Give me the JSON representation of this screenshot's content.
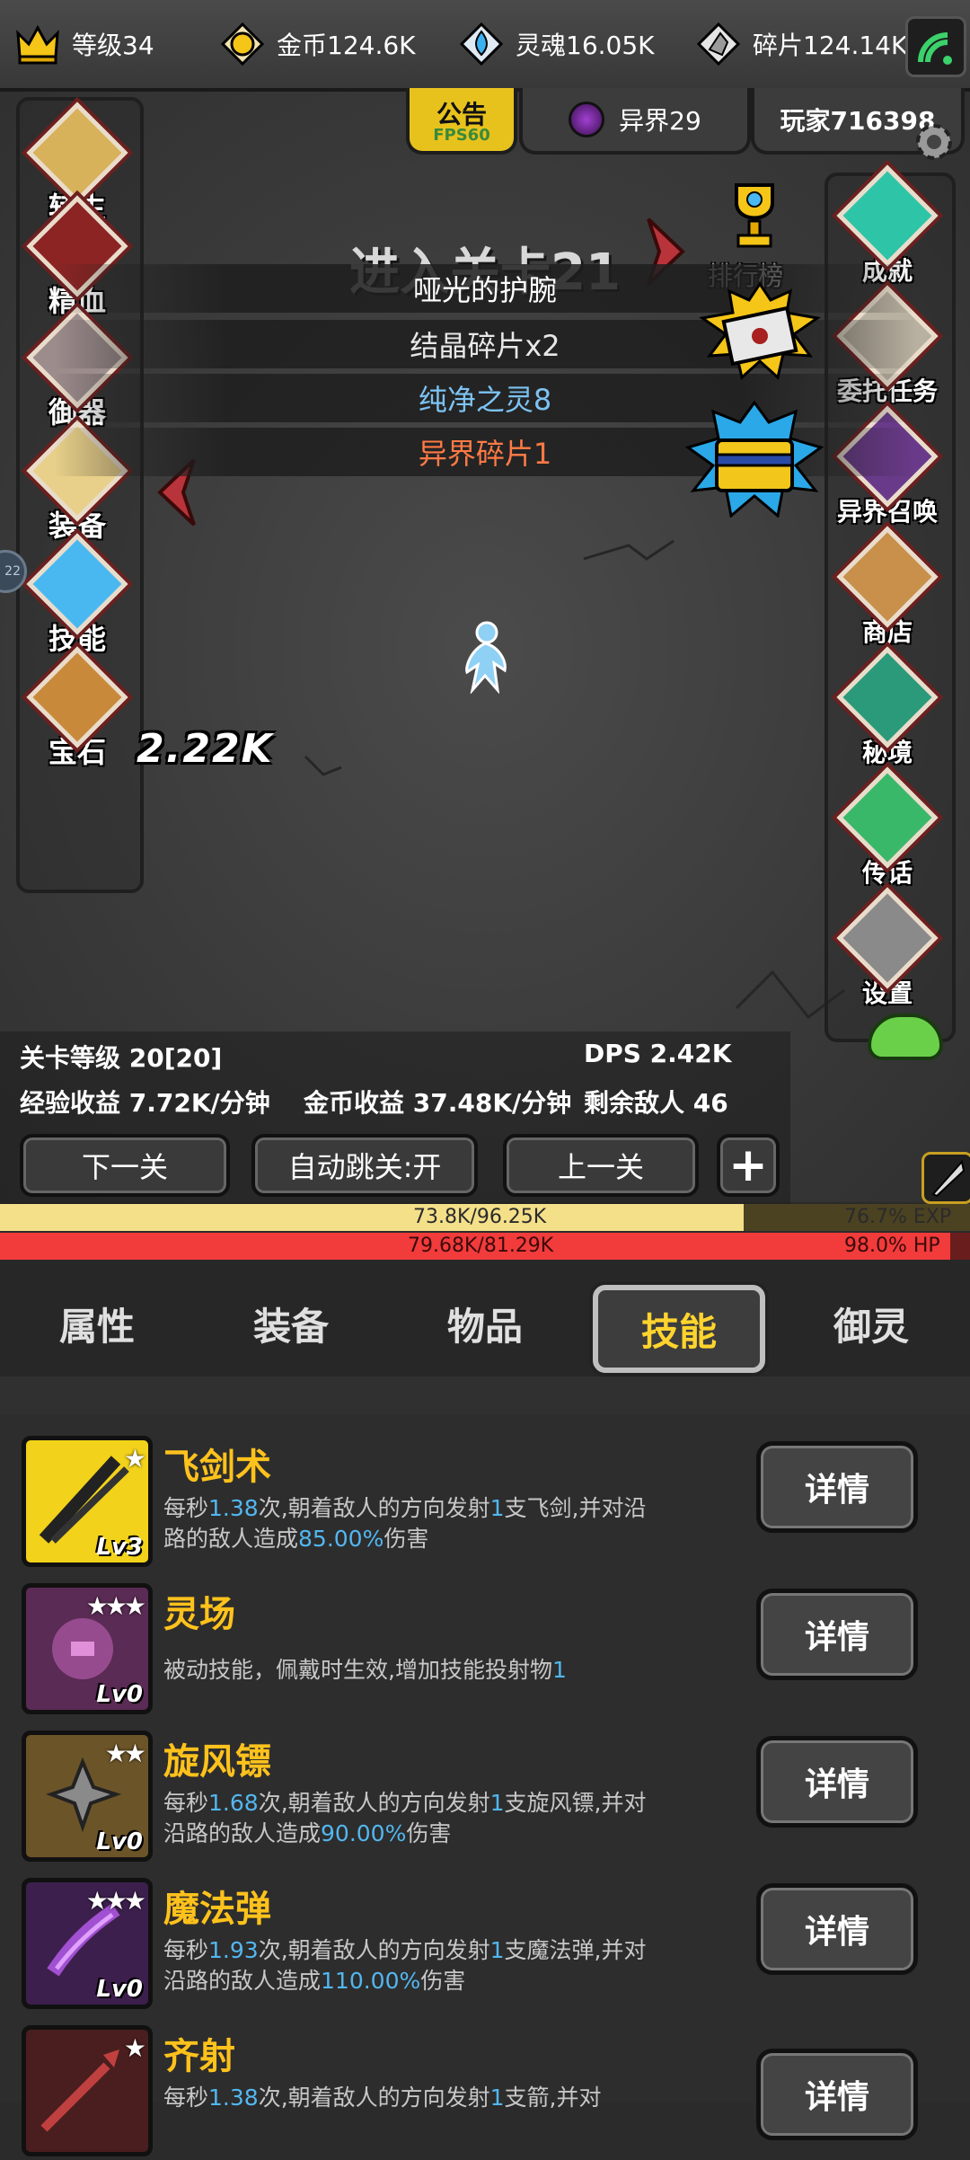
{
  "resources": {
    "level": "等级34",
    "gold": "金币124.6K",
    "soul": "灵魂16.05K",
    "shards": "碎片124.14K"
  },
  "top_tabs": {
    "notice": "公告",
    "fps": "FPS60",
    "otherworld": "异界29",
    "player": "玩家716398"
  },
  "left_nav": [
    "转生",
    "精血",
    "御器",
    "装备",
    "技能",
    "宝石"
  ],
  "right_nav": {
    "ranking": "排行榜",
    "items": [
      "成就",
      "委托任务",
      "异界召唤",
      "商店",
      "秘境",
      "传话",
      "设置"
    ]
  },
  "stage": {
    "title": "进入关卡21",
    "rewards": [
      {
        "text": "哑光的护腕",
        "color": "#ffffff"
      },
      {
        "text": "结晶碎片x2",
        "color": "#e8e8e8"
      },
      {
        "text": "纯净之灵8",
        "color": "#7cc3f2"
      },
      {
        "text": "异界碎片1",
        "color": "#ff7a45"
      }
    ],
    "damage_popup": "2.22K",
    "side_badge": "22"
  },
  "stats": {
    "stage_level": "关卡等级 20[20]",
    "dps": "DPS 2.42K",
    "exp_rate": "经验收益 7.72K/分钟",
    "gold_rate": "金币收益 37.48K/分钟",
    "enemies_left": "剩余敌人 46"
  },
  "buttons": {
    "next": "下一关",
    "auto_skip": "自动跳关:开",
    "prev": "上一关",
    "plus": "+"
  },
  "bars": {
    "exp_text": "73.8K/96.25K",
    "exp_percent": "76.7% EXP",
    "exp_fraction": 0.767,
    "hp_text": "79.68K/81.29K",
    "hp_percent": "98.0%  HP",
    "hp_fraction": 0.98
  },
  "tabs": [
    "属性",
    "装备",
    "物品",
    "技能",
    "御灵"
  ],
  "active_tab": "技能",
  "skills": [
    {
      "name": "飞剑术",
      "level": "Lv3",
      "stars": "★",
      "desc": [
        [
          "每秒",
          false
        ],
        [
          "1.38",
          true
        ],
        [
          "次,朝着敌人的方向发射",
          false
        ],
        [
          "1",
          true
        ],
        [
          "支飞剑,并对沿路的敌人造成",
          false
        ],
        [
          "85.00%",
          true
        ],
        [
          "伤害",
          false
        ]
      ],
      "button": "详情",
      "icon_color": "#f2d21a"
    },
    {
      "name": "灵场",
      "level": "Lv0",
      "stars": "★★★",
      "desc": [
        [
          "被动技能，佩戴时生效,增加技能投射物",
          false
        ],
        [
          "1",
          true
        ]
      ],
      "button": "详情",
      "icon_color": "#5a2b54"
    },
    {
      "name": "旋风镖",
      "level": "Lv0",
      "stars": "★★",
      "desc": [
        [
          "每秒",
          false
        ],
        [
          "1.68",
          true
        ],
        [
          "次,朝着敌人的方向发射",
          false
        ],
        [
          "1",
          true
        ],
        [
          "支旋风镖,并对沿路的敌人造成",
          false
        ],
        [
          "90.00%",
          true
        ],
        [
          "伤害",
          false
        ]
      ],
      "button": "详情",
      "icon_color": "#6b5428"
    },
    {
      "name": "魔法弹",
      "level": "Lv0",
      "stars": "★★★",
      "desc": [
        [
          "每秒",
          false
        ],
        [
          "1.93",
          true
        ],
        [
          "次,朝着敌人的方向发射",
          false
        ],
        [
          "1",
          true
        ],
        [
          "支魔法弹,并对沿路的敌人造成",
          false
        ],
        [
          "110.00%",
          true
        ],
        [
          "伤害",
          false
        ]
      ],
      "button": "详情",
      "icon_color": "#3d1f4d"
    },
    {
      "name": "齐射",
      "level": "",
      "stars": "★",
      "desc": [
        [
          "每秒",
          false
        ],
        [
          "1.38",
          true
        ],
        [
          "次,朝着敌人的方向发射",
          false
        ],
        [
          "1",
          true
        ],
        [
          "支箭,并对",
          false
        ]
      ],
      "button": "详情",
      "icon_color": "#4a1e1e"
    }
  ]
}
